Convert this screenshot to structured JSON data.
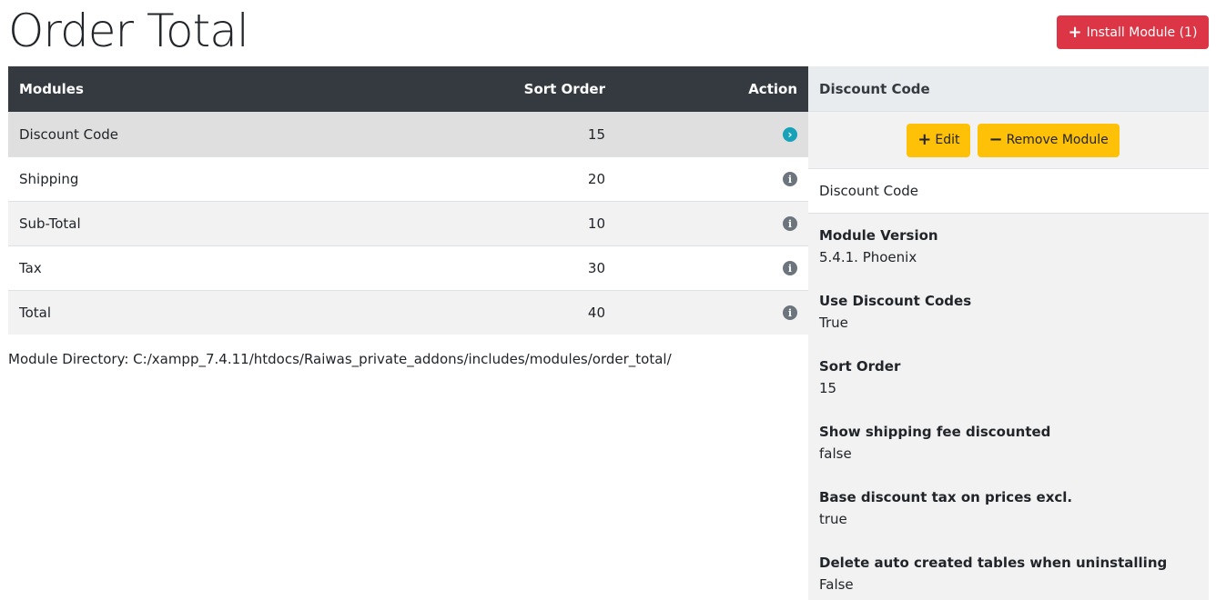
{
  "page": {
    "title": "Order Total"
  },
  "install_button": {
    "label": "Install Module (1)"
  },
  "table": {
    "headers": {
      "modules": "Modules",
      "sort_order": "Sort Order",
      "action": "Action"
    },
    "rows": [
      {
        "module": "Discount Code",
        "sort_order": "15",
        "action_icon": "chevron-right-circle-icon",
        "selected": true
      },
      {
        "module": "Shipping",
        "sort_order": "20",
        "action_icon": "info-icon"
      },
      {
        "module": "Sub-Total",
        "sort_order": "10",
        "action_icon": "info-icon"
      },
      {
        "module": "Tax",
        "sort_order": "30",
        "action_icon": "info-icon"
      },
      {
        "module": "Total",
        "sort_order": "40",
        "action_icon": "info-icon"
      }
    ]
  },
  "module_directory": "Module Directory: C:/xampp_7.4.11/htdocs/Raiwas_private_addons/includes/modules/order_total/",
  "sidebar": {
    "header": "Discount Code",
    "edit_label": "Edit",
    "remove_label": "Remove Module",
    "name": "Discount Code",
    "properties": [
      {
        "label": "Module Version",
        "value": "5.4.1. Phoenix"
      },
      {
        "label": "Use Discount Codes",
        "value": "True"
      },
      {
        "label": "Sort Order",
        "value": "15"
      },
      {
        "label": "Show shipping fee discounted",
        "value": "false"
      },
      {
        "label": "Base discount tax on prices excl.",
        "value": "true"
      },
      {
        "label": "Delete auto created tables when uninstalling",
        "value": "False"
      }
    ]
  },
  "colors": {
    "danger": "#dc3545",
    "warning": "#ffc107",
    "dark": "#343a40",
    "info": "#17a2b8",
    "secondary": "#6c757d"
  }
}
